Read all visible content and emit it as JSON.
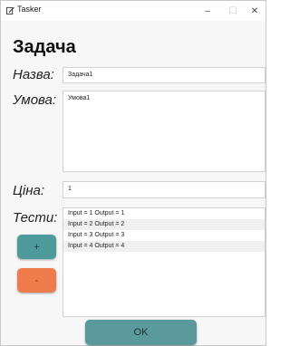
{
  "window": {
    "title": "Tasker",
    "minimize": "–",
    "maximize": "☐",
    "close": "✕"
  },
  "form": {
    "heading": "Задача",
    "name_label": "Назва:",
    "name_value": "Задача1",
    "condition_label": "Умова:",
    "condition_value": "Умова1",
    "price_label": "Ціна:",
    "price_value": "1",
    "tests_label": "Тести:",
    "tests": [
      "Input = 1 Output = 1",
      "Input = 2 Output = 2",
      "Input = 3 Output = 3",
      "Input = 4 Output = 4"
    ]
  },
  "buttons": {
    "add": "+",
    "remove": "-",
    "ok": "OK"
  },
  "colors": {
    "add_button": "#4f9b9b",
    "remove_button": "#f07c4e",
    "ok_button": "#5a9a9c"
  },
  "icons": {
    "app": "edit-icon"
  }
}
